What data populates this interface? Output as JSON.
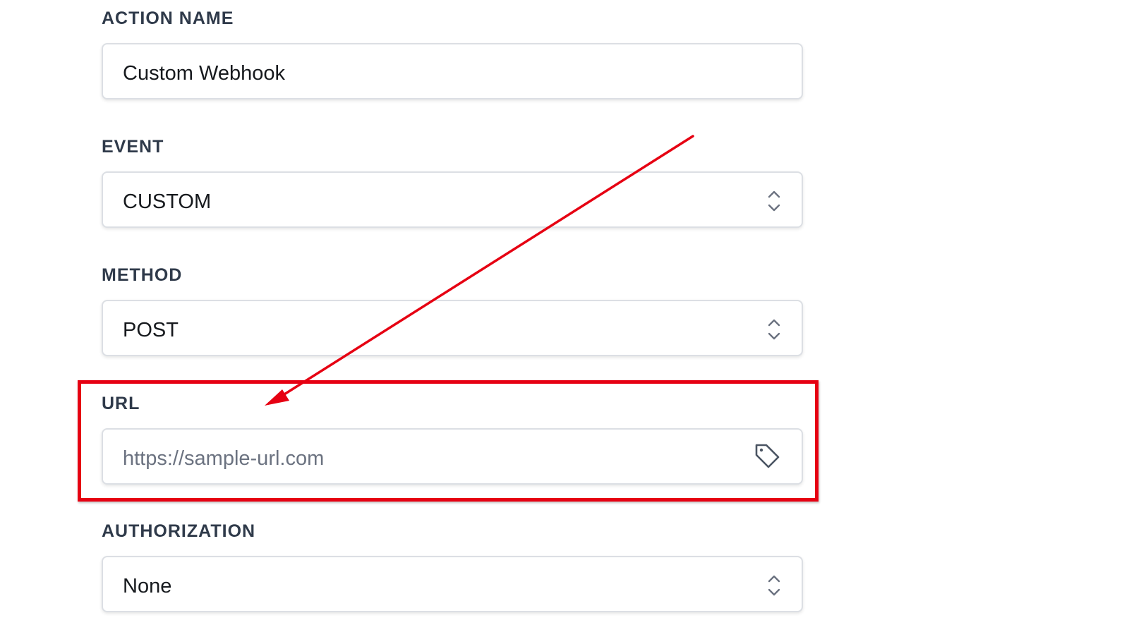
{
  "form": {
    "action_name": {
      "label": "ACTION NAME",
      "value": "Custom Webhook"
    },
    "event": {
      "label": "EVENT",
      "value": "CUSTOM"
    },
    "method": {
      "label": "METHOD",
      "value": "POST"
    },
    "url": {
      "label": "URL",
      "placeholder": "https://sample-url.com",
      "icon": "tag-icon"
    },
    "authorization": {
      "label": "AUTHORIZATION",
      "value": "None"
    }
  },
  "annotation": {
    "color": "#e60012",
    "type": "arrow-and-highlight-box",
    "target": "url-field"
  },
  "colors": {
    "label": "#2f3a4a",
    "border": "#dcdfe4",
    "text": "#16191d",
    "placeholder": "#6b7280"
  }
}
